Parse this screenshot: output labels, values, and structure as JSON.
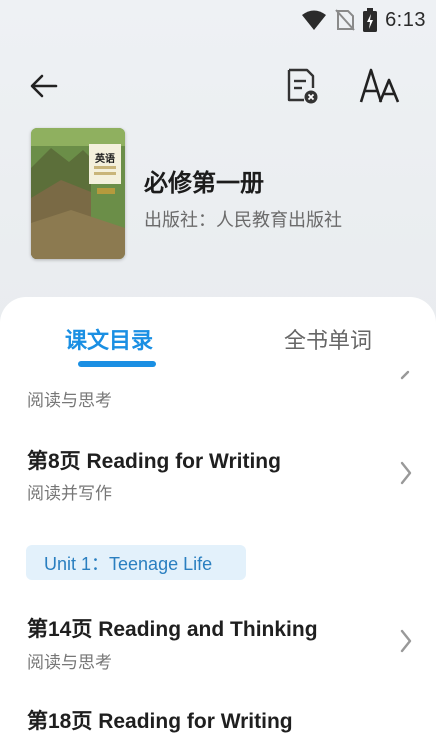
{
  "status_bar": {
    "time": "6:13",
    "icons": [
      "wifi-icon",
      "no-sim-icon",
      "battery-charging-icon"
    ]
  },
  "toolbar": {
    "back_icon": "arrow-left-icon",
    "doc_icon": "document-close-icon",
    "font_icon": "font-size-icon"
  },
  "book": {
    "title": "必修第一册",
    "publisher": "出版社：人民教育出版社",
    "cover_label": "英语"
  },
  "tabs": [
    {
      "label": "课文目录",
      "active": true
    },
    {
      "label": "全书单词",
      "active": false
    }
  ],
  "lessons": [
    {
      "subtitle": "阅读与思考"
    },
    {
      "title": "第8页 Reading for Writing",
      "subtitle": "阅读并写作"
    },
    {
      "title": "第14页 Reading and Thinking",
      "subtitle": "阅读与思考"
    },
    {
      "title": "第18页 Reading for Writing"
    }
  ],
  "unit": {
    "label": "Unit 1：Teenage Life"
  },
  "colors": {
    "accent": "#1a8fe3",
    "badge_bg": "#e3f1fb",
    "badge_text": "#2a7fc0"
  }
}
